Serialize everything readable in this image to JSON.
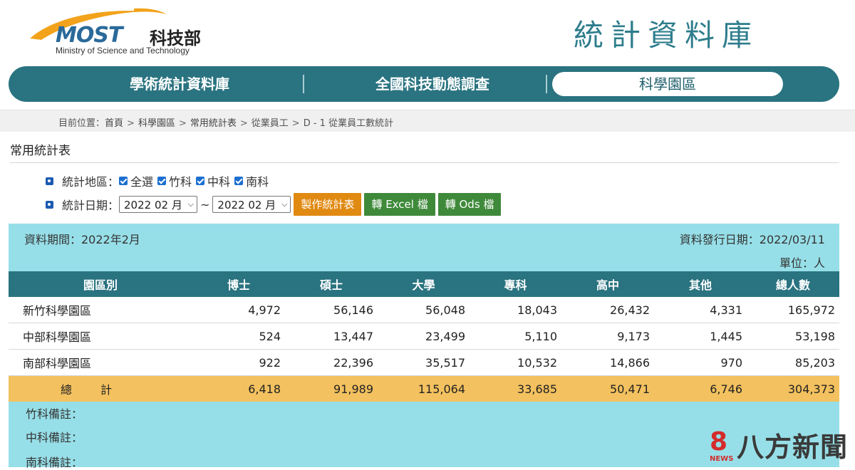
{
  "header": {
    "logo_text": "MOST",
    "logo_cn": "科技部",
    "logo_en": "Ministry of Science and Technology",
    "site_title": "統計資料庫"
  },
  "nav": {
    "items": [
      {
        "label": "學術統計資料庫"
      },
      {
        "label": "全國科技動態調查"
      },
      {
        "label": "科學園區"
      }
    ]
  },
  "breadcrumb": {
    "prefix": "目前位置：",
    "items": [
      "首頁",
      "科學園區",
      "常用統計表",
      "從業員工",
      "D - 1 從業員工數統計"
    ]
  },
  "section_title": "常用統計表",
  "filters": {
    "region_label": "統計地區：",
    "regions": [
      "全選",
      "竹科",
      "中科",
      "南科"
    ],
    "date_label": "統計日期：",
    "start_date": "2022 02 月",
    "end_date": "2022 02 月",
    "tilde": "~",
    "make_button": "製作統計表",
    "excel_button": "轉 Excel 檔",
    "ods_button": "轉 Ods 檔"
  },
  "panel": {
    "period": "資料期間：2022年2月",
    "release": "資料發行日期：2022/03/11",
    "unit": "單位：人"
  },
  "table": {
    "headers": [
      "園區別",
      "博士",
      "碩士",
      "大學",
      "專科",
      "高中",
      "其他",
      "總人數"
    ],
    "rows": [
      [
        "新竹科學園區",
        "4,972",
        "56,146",
        "56,048",
        "18,043",
        "26,432",
        "4,331",
        "165,972"
      ],
      [
        "中部科學園區",
        "524",
        "13,447",
        "23,499",
        "5,110",
        "9,173",
        "1,445",
        "53,198"
      ],
      [
        "南部科學園區",
        "922",
        "22,396",
        "35,517",
        "10,532",
        "14,866",
        "970",
        "85,203"
      ]
    ],
    "total": [
      "總計",
      "6,418",
      "91,989",
      "115,064",
      "33,685",
      "50,471",
      "6,746",
      "304,373"
    ]
  },
  "notes": [
    "竹科備註：",
    "中科備註：",
    "南科備註："
  ],
  "watermark": {
    "mark": "8",
    "sub": "NEWS",
    "text": "八方新聞"
  },
  "colors": {
    "nav_bg": "#2a7380",
    "panel_bg": "#97dfe8",
    "total_row": "#f3c15f",
    "make_button": "#e08a12",
    "export_button": "#3f8a3a"
  }
}
